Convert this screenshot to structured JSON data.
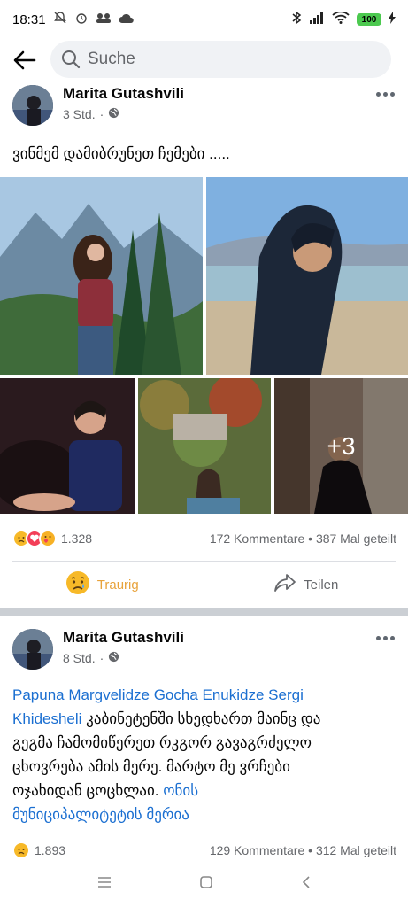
{
  "status": {
    "time": "18:31",
    "battery": "100"
  },
  "search": {
    "placeholder": "Suche"
  },
  "posts": [
    {
      "author": "Marita Gutashvili",
      "time": "3 Std.",
      "text": "ვინმემ დამიბრუნეთ ჩემები .....",
      "more_photos": "+3",
      "reactions_count": "1.328",
      "comments": "172 Kommentare",
      "shares": "387 Mal geteilt",
      "actions": {
        "react_label": "Traurig",
        "share_label": "Teilen"
      }
    },
    {
      "author": "Marita Gutashvili",
      "time": "8 Std.",
      "mention_1": "Papuna Margvelidze Gocha Enukidze Sergi",
      "mention_2": "Khidesheli",
      "text_1": " კაბინეტენში სხედხართ მაინც და",
      "text_2": "გეგმა ჩამომიწერეთ რკგორ გავაგრძელო",
      "text_3": "ცხოვრება ამის მერე. მარტო მე ვრჩები",
      "text_4": "ოჯახიდან ცოცხლაი. ",
      "mention_3": "ონის",
      "mention_4": "მუნიციპალიტეტის მერია",
      "reactions_count": "1.893",
      "comments": "129 Kommentare",
      "shares": "312 Mal geteilt"
    }
  ],
  "colors": {
    "link": "#1b6fd1",
    "sad": "#f7b928",
    "love": "#f33e58",
    "care": "#f7b125"
  }
}
